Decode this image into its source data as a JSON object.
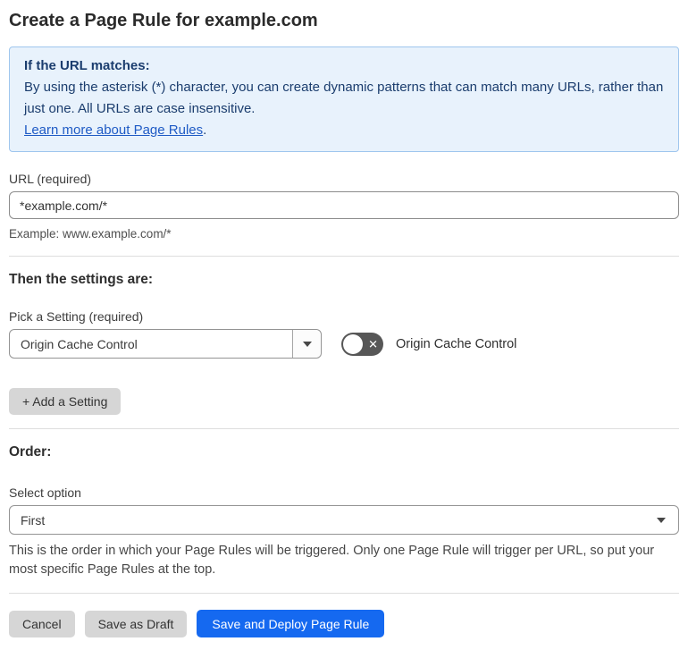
{
  "page": {
    "title": "Create a Page Rule for example.com"
  },
  "info_box": {
    "heading": "If the URL matches:",
    "body": "By using the asterisk (*) character, you can create dynamic patterns that can match many URLs, rather than just one. All URLs are case insensitive.",
    "link_label": "Learn more about Page Rules",
    "link_suffix": "."
  },
  "url_field": {
    "label": "URL (required)",
    "value": "*example.com/*",
    "helper": "Example: www.example.com/*"
  },
  "settings_section": {
    "heading": "Then the settings are:",
    "picker_label": "Pick a Setting (required)",
    "picker_value": "Origin Cache Control",
    "toggle_label": "Origin Cache Control",
    "toggle_state": "off",
    "toggle_off_icon": "✕",
    "add_setting_label": "+ Add a Setting"
  },
  "order_section": {
    "heading": "Order:",
    "select_label": "Select option",
    "select_value": "First",
    "helper": "This is the order in which your Page Rules will be triggered. Only one Page Rule will trigger per URL, so put your most specific Page Rules at the top."
  },
  "actions": {
    "cancel_label": "Cancel",
    "save_draft_label": "Save as Draft",
    "save_deploy_label": "Save and Deploy Page Rule"
  },
  "colors": {
    "primary_blue": "#1569f0",
    "info_background": "#e8f2fc",
    "info_border": "#9fc6ee",
    "info_text": "#1b3d6e",
    "link_blue": "#1f5bc5",
    "toggle_off_background": "#575757",
    "gray_button": "#d6d6d6"
  }
}
